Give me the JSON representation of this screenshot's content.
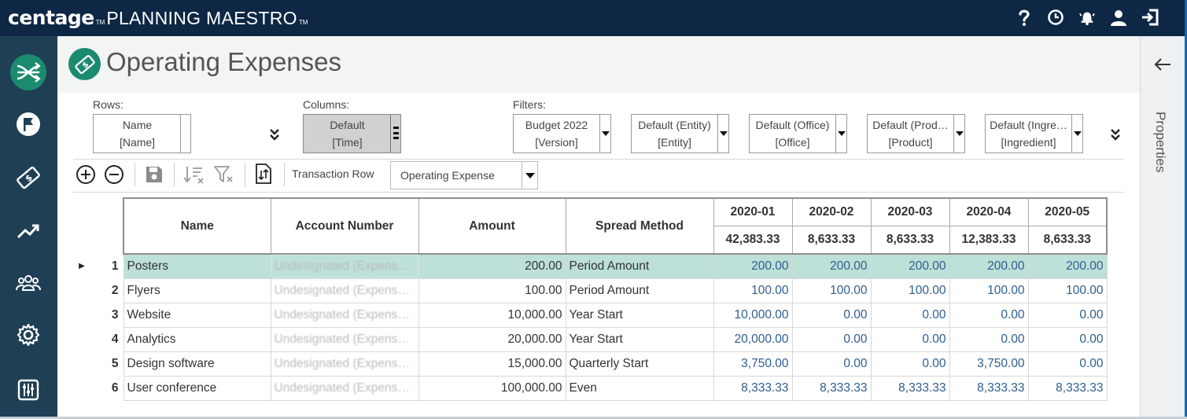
{
  "app": {
    "brand": "centage",
    "brand_tm": "TM",
    "product": "PLANNING MAESTRO",
    "product_tm": "TM"
  },
  "top_icons": [
    "help-icon",
    "clock-icon",
    "alert-icon",
    "user-icon",
    "logout-icon"
  ],
  "rail": [
    "workflow-icon",
    "flag-icon",
    "expense-icon",
    "trend-icon",
    "team-icon",
    "settings-icon",
    "sliders-icon"
  ],
  "page": {
    "title": "Operating Expenses"
  },
  "pivot": {
    "rows_label": "Rows:",
    "rows": {
      "line1": "Name",
      "line2": "[Name]"
    },
    "columns_label": "Columns:",
    "columns": {
      "line1": "Default",
      "line2": "[Time]"
    },
    "filters_label": "Filters:",
    "filters": [
      {
        "line1": "Budget 2022",
        "line2": "[Version]"
      },
      {
        "line1": "Default (Entity)",
        "line2": "[Entity]"
      },
      {
        "line1": "Default (Office)",
        "line2": "[Office]"
      },
      {
        "line1": "Default (Prod…",
        "line2": "[Product]"
      },
      {
        "line1": "Default (Ingre…",
        "line2": "[Ingredient]"
      }
    ]
  },
  "toolbar": {
    "transaction_label": "Transaction Row",
    "transaction_value": "Operating Expense"
  },
  "grid": {
    "headers": {
      "name": "Name",
      "account": "Account Number",
      "amount": "Amount",
      "spread": "Spread Method"
    },
    "periods": [
      {
        "label": "2020-01",
        "total": "42,383.33"
      },
      {
        "label": "2020-02",
        "total": "8,633.33"
      },
      {
        "label": "2020-03",
        "total": "8,633.33"
      },
      {
        "label": "2020-04",
        "total": "12,383.33"
      },
      {
        "label": "2020-05",
        "total": "8,633.33"
      }
    ],
    "rows": [
      {
        "num": "1",
        "name": "Posters",
        "account": "Undesignated (Expens…",
        "amount": "200.00",
        "spread": "Period Amount",
        "values": [
          "200.00",
          "200.00",
          "200.00",
          "200.00",
          "200.00"
        ]
      },
      {
        "num": "2",
        "name": "Flyers",
        "account": "Undesignated (Expens…",
        "amount": "100.00",
        "spread": "Period Amount",
        "values": [
          "100.00",
          "100.00",
          "100.00",
          "100.00",
          "100.00"
        ]
      },
      {
        "num": "3",
        "name": "Website",
        "account": "Undesignated (Expens…",
        "amount": "10,000.00",
        "spread": "Year Start",
        "values": [
          "10,000.00",
          "0.00",
          "0.00",
          "0.00",
          "0.00"
        ]
      },
      {
        "num": "4",
        "name": "Analytics",
        "account": "Undesignated (Expens…",
        "amount": "20,000.00",
        "spread": "Year Start",
        "values": [
          "20,000.00",
          "0.00",
          "0.00",
          "0.00",
          "0.00"
        ]
      },
      {
        "num": "5",
        "name": "Design software",
        "account": "Undesignated (Expens…",
        "amount": "15,000.00",
        "spread": "Quarterly Start",
        "values": [
          "3,750.00",
          "0.00",
          "0.00",
          "3,750.00",
          "0.00"
        ]
      },
      {
        "num": "6",
        "name": "User conference",
        "account": "Undesignated (Expens…",
        "amount": "100,000.00",
        "spread": "Even",
        "values": [
          "8,333.33",
          "8,333.33",
          "8,333.33",
          "8,333.33",
          "8,333.33"
        ]
      }
    ],
    "selected_row": 0
  },
  "properties": {
    "label": "Properties"
  },
  "colors": {
    "topbar": "#0d2744",
    "rail": "#1f3f54",
    "accent": "#1c8a6e",
    "selected_row": "#bde0d8",
    "period_value": "#2f5d8e"
  }
}
